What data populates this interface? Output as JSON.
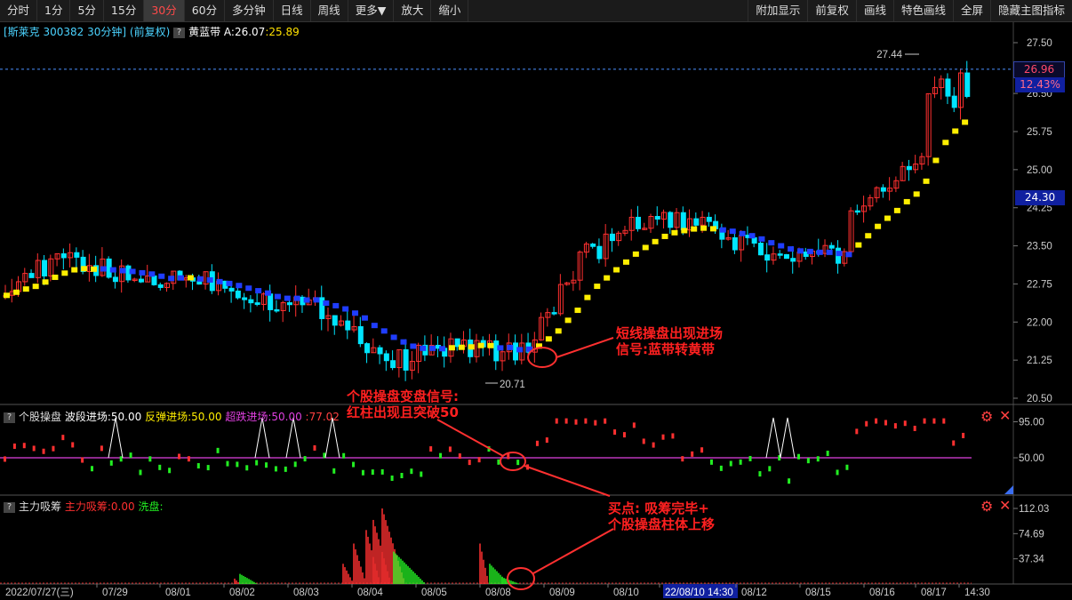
{
  "toolbar": {
    "left": [
      "分时",
      "1分",
      "5分",
      "15分",
      "30分",
      "60分",
      "多分钟",
      "日线",
      "周线",
      "更多▼",
      "放大",
      "缩小"
    ],
    "active_index": 4,
    "right": [
      "附加显示",
      "前复权",
      "画线",
      "特色画线",
      "全屏",
      "隐藏主图指标"
    ]
  },
  "price_panel": {
    "title_code": "[斯莱克 300382 30分钟] (前复权)",
    "indicator_name": "黄蓝带",
    "a_label": "A:26.07",
    "b_label": ":25.89",
    "y_ticks": [
      "27.50",
      "26.50",
      "25.75",
      "25.00",
      "24.25",
      "23.50",
      "22.75",
      "22.00",
      "21.25",
      "20.50"
    ],
    "current_price": "26.96",
    "current_pct": "12.43%",
    "marker_price": "24.30",
    "high_label": "27.44",
    "low_label": "20.71"
  },
  "osc_panel": {
    "name": "个股操盘",
    "wave_label": "波段进场:50.00",
    "rebound_label": "反弹进场:50.00",
    "oversold_label": "超跌进场:50.00",
    "value_label": ":77.02",
    "y_ticks": [
      "95.00",
      "50.00"
    ]
  },
  "vol_panel": {
    "name": "主力吸筹",
    "absorb_label": "主力吸筹:0.00",
    "wash_label": "洗盘:",
    "y_ticks": [
      "112.03",
      "74.69",
      "37.34"
    ]
  },
  "x_axis": {
    "labels": [
      "2022/07/27(三)",
      "07/29",
      "08/01",
      "08/02",
      "08/03",
      "08/04",
      "08/05",
      "08/08",
      "08/09",
      "08/10",
      "22/08/10 14:30",
      "08/12",
      "08/15",
      "08/16",
      "08/17",
      "14:30"
    ],
    "highlight_index": 10
  },
  "annotations": {
    "note1": [
      "短线操盘出现进场",
      "信号:蓝带转黄带"
    ],
    "note2": [
      "个股操盘变盘信号:",
      "红柱出现且突破50"
    ],
    "note3": [
      "买点:  吸筹完毕+",
      "个股操盘柱体上移"
    ]
  },
  "colors": {
    "up": "#ff3030",
    "down": "#00e5ff",
    "yellow": "#ffee00",
    "blue": "#1f3dff",
    "magenta": "#e040e0",
    "green": "#22ee22"
  },
  "chart_data": [
    {
      "type": "candlestick",
      "title": "斯莱克 300382 30分钟",
      "ylim": [
        20.5,
        27.5
      ],
      "x_range": [
        "2022/07/27",
        "2022/08/17 14:30"
      ],
      "last_close": 26.96,
      "period_high": 27.44,
      "period_low": 20.71,
      "band_last": [
        26.07,
        25.89
      ],
      "anchors": [
        [
          "07/27",
          22.75
        ],
        [
          "07/28",
          23.25
        ],
        [
          "07/29",
          22.8
        ],
        [
          "08/01",
          22.9
        ],
        [
          "08/02",
          22.45
        ],
        [
          "08/03",
          22.25
        ],
        [
          "08/04",
          21.2
        ],
        [
          "08/05",
          21.55
        ],
        [
          "08/08",
          21.35
        ],
        [
          "08/09",
          23.3
        ],
        [
          "08/10",
          24.05
        ],
        [
          "08/11",
          23.8
        ],
        [
          "08/12",
          23.25
        ],
        [
          "08/15",
          23.3
        ],
        [
          "08/16",
          24.1
        ],
        [
          "08/17",
          26.96
        ]
      ]
    },
    {
      "type": "bar",
      "title": "个股操盘",
      "ylim": [
        0,
        100
      ],
      "reference": 50,
      "last_value": 77.02
    },
    {
      "type": "bar",
      "title": "主力吸筹",
      "ylim": [
        0,
        112.03
      ],
      "peaks": [
        [
          "08/04",
          112.03
        ],
        [
          "08/08",
          60
        ]
      ]
    }
  ]
}
